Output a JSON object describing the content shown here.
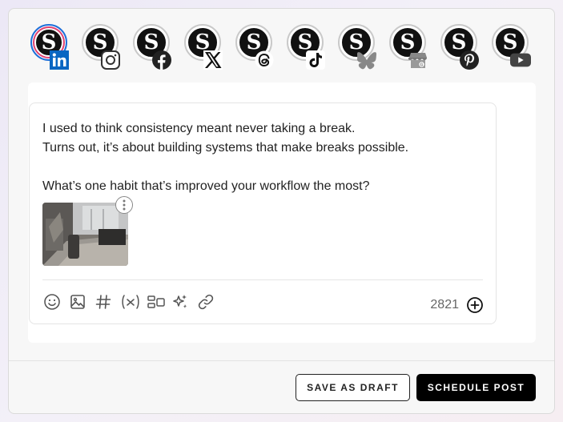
{
  "profiles": [
    {
      "network": "LinkedIn",
      "icon": "linkedin-icon",
      "avatar_letter": "S",
      "selected": true,
      "brand_color": "#0a66c2"
    },
    {
      "network": "Instagram",
      "icon": "instagram-icon",
      "avatar_letter": "S",
      "selected": false
    },
    {
      "network": "Facebook",
      "icon": "facebook-icon",
      "avatar_letter": "S",
      "selected": false
    },
    {
      "network": "X",
      "icon": "x-icon",
      "avatar_letter": "S",
      "selected": false
    },
    {
      "network": "Threads",
      "icon": "threads-icon",
      "avatar_letter": "S",
      "selected": false
    },
    {
      "network": "TikTok",
      "icon": "tiktok-icon",
      "avatar_letter": "S",
      "selected": false
    },
    {
      "network": "Bluesky",
      "icon": "bluesky-icon",
      "avatar_letter": "S",
      "selected": false
    },
    {
      "network": "Google Business",
      "icon": "google-business-icon",
      "avatar_letter": "S",
      "selected": false
    },
    {
      "network": "Pinterest",
      "icon": "pinterest-icon",
      "avatar_letter": "S",
      "selected": false
    },
    {
      "network": "YouTube",
      "icon": "youtube-icon",
      "avatar_letter": "S",
      "selected": false
    }
  ],
  "editor": {
    "text": "I used to think consistency meant never taking a break.\nTurns out, it’s about building systems that make breaks possible.\n\nWhat’s one habit that’s improved your workflow the most?",
    "character_count": "2821",
    "toolbar": [
      "emoji-icon",
      "image-icon",
      "hashtag-icon",
      "variable-icon",
      "layout-icon",
      "ai-sparkle-icon",
      "link-icon"
    ]
  },
  "actions": {
    "draft_label": "SAVE AS DRAFT",
    "schedule_label": "SCHEDULE POST"
  },
  "colors": {
    "accent_selected": "#1e6fd9",
    "primary_button": "#000000"
  }
}
